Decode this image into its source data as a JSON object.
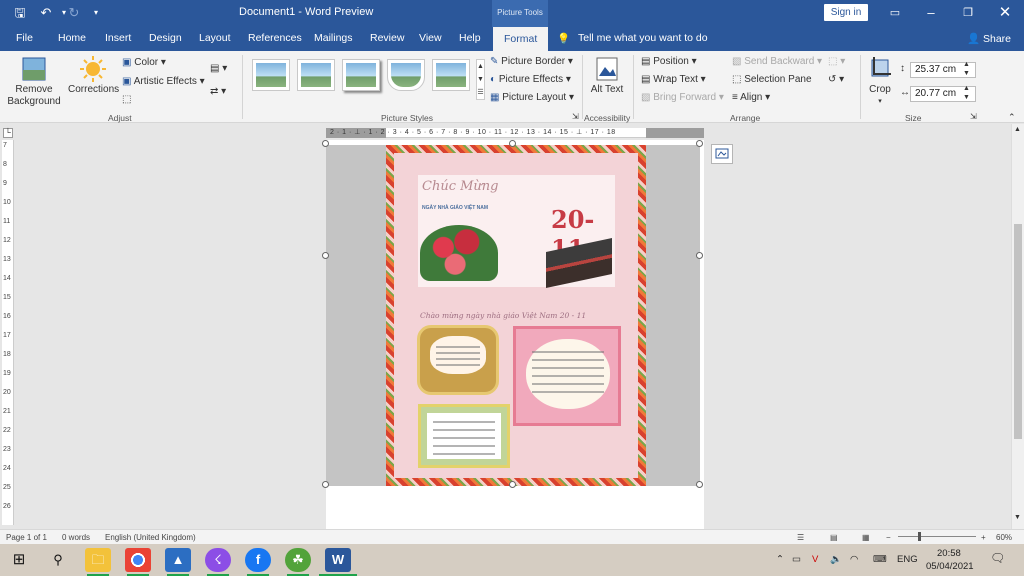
{
  "titlebar": {
    "document_title": "Document1  -  Word Preview",
    "contextual_tab": "Picture Tools",
    "sign_in": "Sign in",
    "quick_access": [
      "save-icon",
      "undo-icon",
      "redo-icon",
      "customize-icon"
    ]
  },
  "tabs": [
    "File",
    "Home",
    "Insert",
    "Design",
    "Layout",
    "References",
    "Mailings",
    "Review",
    "View",
    "Help",
    "Format"
  ],
  "active_tab": "Format",
  "tell_me": "Tell me what you want to do",
  "share": "Share",
  "ribbon": {
    "adjust": {
      "label": "Adjust",
      "remove_background": "Remove Background",
      "corrections": "Corrections",
      "color": "Color",
      "artistic_effects": "Artistic Effects"
    },
    "picture_styles": {
      "label": "Picture Styles",
      "picture_border": "Picture Border",
      "picture_effects": "Picture Effects",
      "picture_layout": "Picture Layout"
    },
    "accessibility": {
      "label": "Accessibility",
      "alt_text": "Alt Text"
    },
    "arrange": {
      "label": "Arrange",
      "position": "Position",
      "wrap_text": "Wrap Text",
      "bring_forward": "Bring Forward",
      "send_backward": "Send Backward",
      "selection_pane": "Selection Pane",
      "align": "Align"
    },
    "size": {
      "label": "Size",
      "crop": "Crop",
      "height": "25.37 cm",
      "width": "20.77 cm"
    }
  },
  "ruler_h": "2 · 1 · ⊥ · 1 · 2 · 3 · 4 · 5 · 6 · 7 · 8 · 9 · 10 · 11 · 12 · 13 · 14 · 15 · ⊥ · 17 · 18",
  "ruler_v": [
    "7",
    "8",
    "9",
    "10",
    "11",
    "12",
    "13",
    "14",
    "15",
    "16",
    "17",
    "18",
    "19",
    "20",
    "21",
    "22",
    "23",
    "24",
    "25",
    "26"
  ],
  "poster": {
    "script_title": "Chúc Mừng",
    "subtitle": "NGÀY NHÀ GIÁO VIỆT NAM",
    "date": "20-11",
    "greeting_line": "Chào mừng ngày nhà giáo Việt Nam 20 - 11"
  },
  "status": {
    "page": "Page 1 of 1",
    "words": "0 words",
    "language": "English (United Kingdom)",
    "zoom": "60%"
  },
  "taskbar": {
    "language": "ENG",
    "time": "20:58",
    "date": "05/04/2021",
    "apps": [
      "start-icon",
      "search-icon",
      "file-explorer-icon",
      "chrome-icon",
      "photos-icon",
      "messenger-icon",
      "facebook-icon",
      "app-icon",
      "word-icon"
    ]
  }
}
